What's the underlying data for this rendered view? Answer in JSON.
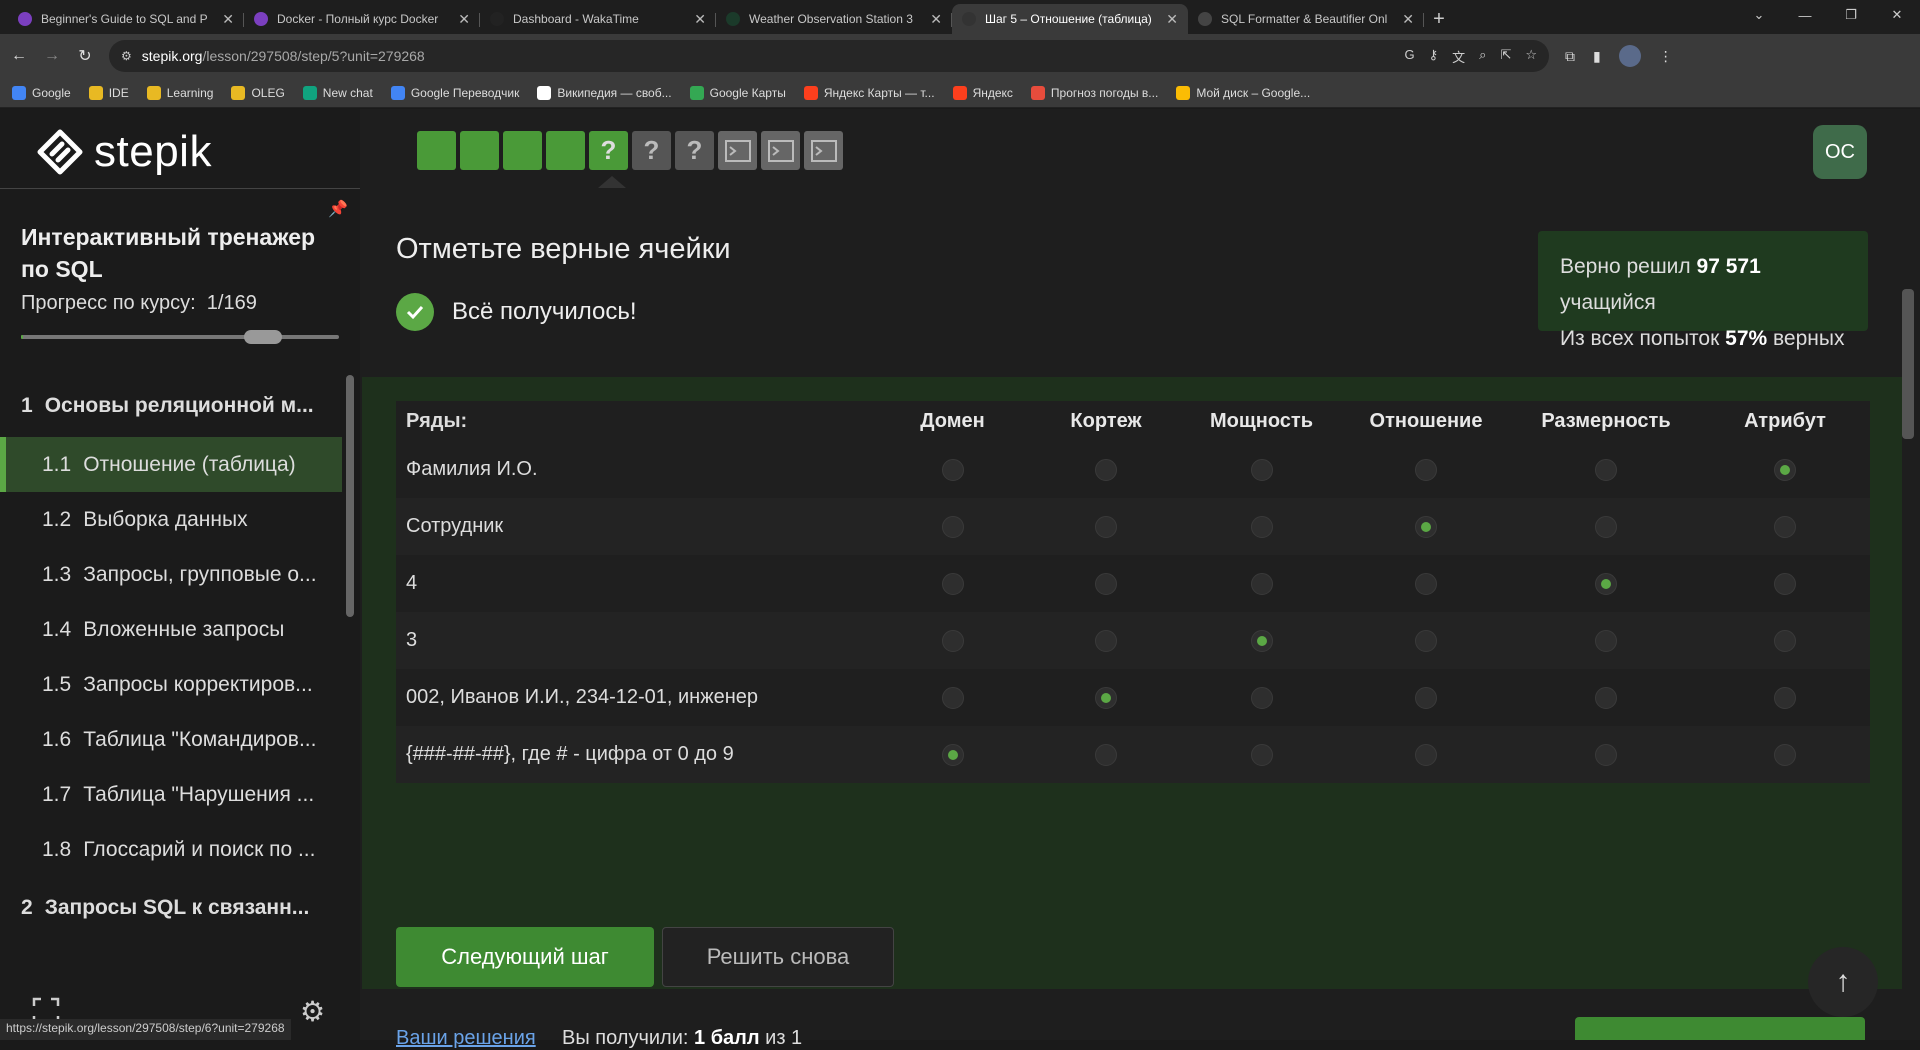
{
  "browser": {
    "tabs": [
      {
        "title": "Beginner's Guide to SQL and P",
        "icon_color": "#7b3fbf",
        "active": false
      },
      {
        "title": "Docker - Полный курс Docker",
        "icon_color": "#7b3fbf",
        "active": false
      },
      {
        "title": "Dashboard - WakaTime",
        "icon_color": "#222222",
        "active": false
      },
      {
        "title": "Weather Observation Station 3",
        "icon_color": "#1b3a2a",
        "active": false
      },
      {
        "title": "Шаг 5 – Отношение (таблица)",
        "icon_color": "#333333",
        "active": true
      },
      {
        "title": "SQL Formatter & Beautifier Onl",
        "icon_color": "#444444",
        "active": false
      }
    ],
    "url_site": "stepik.org",
    "url_path": "/lesson/297508/step/5?unit=279268",
    "bookmarks": [
      {
        "label": "Google",
        "color": "#4285f4"
      },
      {
        "label": "IDE",
        "color": "#e8b923"
      },
      {
        "label": "Learning",
        "color": "#e8b923"
      },
      {
        "label": "OLEG",
        "color": "#e8b923"
      },
      {
        "label": "New chat",
        "color": "#10a37f"
      },
      {
        "label": "Google Переводчик",
        "color": "#4285f4"
      },
      {
        "label": "Википедия — своб...",
        "color": "#ffffff"
      },
      {
        "label": "Google Карты",
        "color": "#34a853"
      },
      {
        "label": "Яндекс Карты — т...",
        "color": "#fc3f1d"
      },
      {
        "label": "Яндекс",
        "color": "#fc3f1d"
      },
      {
        "label": "Прогноз погоды в...",
        "color": "#e74c3c"
      },
      {
        "label": "Мой диск – Google...",
        "color": "#fbbc04"
      }
    ],
    "status_url": "https://stepik.org/lesson/297508/step/6?unit=279268"
  },
  "sidebar": {
    "logo": "stepik",
    "course_title": "Интерактивный тренажер по SQL",
    "progress_label": "Прогресс по курсу:",
    "progress_value": "1/169",
    "progress_fraction": 0.006,
    "toc": [
      {
        "num": "1",
        "label": "Основы реляционной м...",
        "type": "module",
        "active": false
      },
      {
        "num": "1.1",
        "label": "Отношение (таблица)",
        "type": "lesson",
        "active": true
      },
      {
        "num": "1.2",
        "label": "Выборка данных",
        "type": "lesson",
        "active": false
      },
      {
        "num": "1.3",
        "label": "Запросы, групповые о...",
        "type": "lesson",
        "active": false
      },
      {
        "num": "1.4",
        "label": "Вложенные запросы",
        "type": "lesson",
        "active": false
      },
      {
        "num": "1.5",
        "label": "Запросы корректиров...",
        "type": "lesson",
        "active": false
      },
      {
        "num": "1.6",
        "label": "Таблица \"Командиров...",
        "type": "lesson",
        "active": false
      },
      {
        "num": "1.7",
        "label": "Таблица \"Нарушения ...",
        "type": "lesson",
        "active": false
      },
      {
        "num": "1.8",
        "label": "Глоссарий и поиск по ...",
        "type": "lesson",
        "active": false
      },
      {
        "num": "2",
        "label": "Запросы SQL к связанн...",
        "type": "module",
        "active": false
      }
    ]
  },
  "main": {
    "steps": [
      "done",
      "done",
      "done",
      "done",
      "current",
      "q",
      "q",
      "code",
      "code",
      "code"
    ],
    "user_initials": "OC",
    "task_title": "Отметьте верные ячейки",
    "success_text": "Всё получилось!",
    "stats": {
      "line1_prefix": "Верно решил",
      "solved_count": "97 571",
      "line1_suffix": "учащийся",
      "line2_prefix": "Из всех попыток",
      "percent": "57%",
      "line2_suffix": "верных"
    },
    "grid": {
      "row_header": "Ряды:",
      "columns": [
        "Домен",
        "Кортеж",
        "Мощность",
        "Отношение",
        "Размерность",
        "Атрибут"
      ],
      "rows": [
        {
          "label": "Фамилия И.О.",
          "selected": 5
        },
        {
          "label": "Сотрудник",
          "selected": 3
        },
        {
          "label": "4",
          "selected": 4
        },
        {
          "label": "3",
          "selected": 2
        },
        {
          "label": "002, Иванов И.И., 234-12-01, инженер",
          "selected": 1
        },
        {
          "label": "{###-##-##}, где # - цифра от 0 до 9",
          "selected": 0
        }
      ]
    },
    "next_button": "Следующий шаг",
    "retry_button": "Решить снова",
    "solutions_link": "Ваши решения",
    "score_prefix": "Вы получили:",
    "score_value": "1 балл",
    "score_suffix": "из 1"
  }
}
